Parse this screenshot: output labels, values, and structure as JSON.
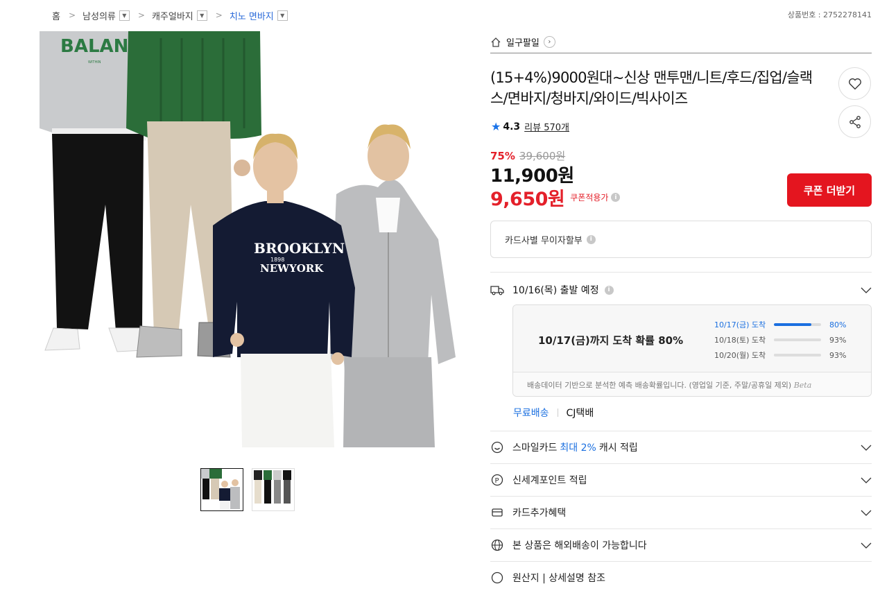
{
  "breadcrumb": [
    {
      "label": "홈"
    },
    {
      "label": "남성의류"
    },
    {
      "label": "캐주얼바지"
    },
    {
      "label": "치노 면바지"
    }
  ],
  "product_number_text": "상품번호 : 2752278141",
  "main_image": {
    "model1_print": "BALANCE",
    "model1_sub": "WITHIN",
    "model3_line1": "BROOKLYN",
    "model3_line2": "1898",
    "model3_line3": "NEWYORK"
  },
  "shop": {
    "name": "일구팔일"
  },
  "title": "(15+4%)9000원대~신상 맨투맨/니트/후드/집업/슬랙스/면바지/청바지/와이드/빅사이즈",
  "rating": {
    "score": "4.3",
    "review_text": "리뷰 570개"
  },
  "discount": {
    "rate": "75%",
    "original": "39,600원"
  },
  "price": "11,900원",
  "coupon_price": "9,650원",
  "coupon_label": "쿠폰적용가",
  "coupon_button": "쿠폰 더받기",
  "card_installment": "카드사별 무이자할부",
  "shipping": {
    "depart_text": "10/16(목) 출발 예정",
    "headline": "10/17(금)까지 도착 확률 80%",
    "rows": [
      {
        "date": "10/17(금) 도착",
        "pct": "80%",
        "value": 0.8
      },
      {
        "date": "10/18(토) 도착",
        "pct": "93%",
        "value": 0.93
      },
      {
        "date": "10/20(월) 도착",
        "pct": "93%",
        "value": 0.93
      }
    ],
    "note": "배송데이터 기반으로 분석한 예측 배송확률입니다. (영업일 기준, 주말/공휴일 제외)",
    "beta": "Beta",
    "free_shipping": "무료배송",
    "carrier": "CJ택배"
  },
  "benefits": {
    "smile_pre": "스마일카드",
    "smile_highlight": "최대 2%",
    "smile_post": "캐시 적립",
    "shinsegae": "신세계포인트 적립",
    "card_extra": "카드추가혜택",
    "overseas": "본 상품은 해외배송이 가능합니다",
    "origin": "원산지 | 상세설명 참조"
  }
}
